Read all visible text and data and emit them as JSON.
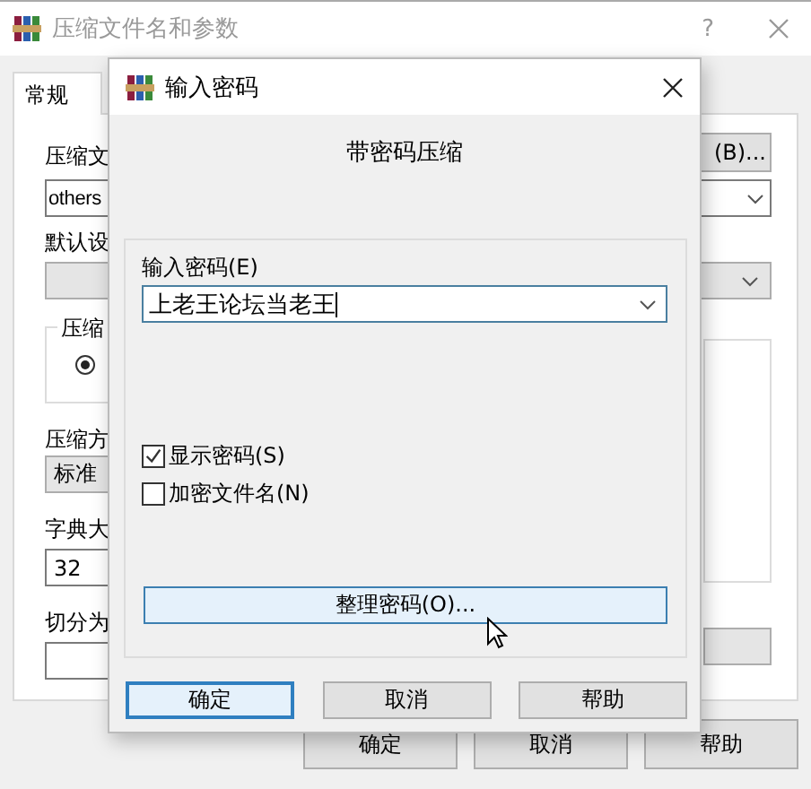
{
  "background_window": {
    "title": "压缩文件名和参数",
    "help": "?",
    "tabs": [
      {
        "label": "常规",
        "selected": true
      }
    ],
    "archive_label": "压缩文",
    "browse_button": "(B)...",
    "archive_name": "others",
    "profile_label": "默认设",
    "group_label": "压缩",
    "radio_selected": true,
    "method_label": "压缩方",
    "method_value": "标准",
    "dictionary_label": "字典大",
    "dictionary_value": "32",
    "split_label": "切分为",
    "buttons": [
      "确定",
      "取消",
      "帮助"
    ]
  },
  "dialog": {
    "title": "输入密码",
    "heading": "带密码压缩",
    "password_label": "输入密码(E)",
    "password_value": "上老王论坛当老王",
    "options": [
      {
        "label": "显示密码(S)",
        "checked": true
      },
      {
        "label": "加密文件名(N)",
        "checked": false
      }
    ],
    "organize_button": {
      "label": "整理密码(O)...",
      "hovered": true
    },
    "buttons": [
      {
        "label": "确定",
        "focused": true
      },
      {
        "label": "取消",
        "focused": false
      },
      {
        "label": "帮助",
        "focused": false
      }
    ]
  }
}
